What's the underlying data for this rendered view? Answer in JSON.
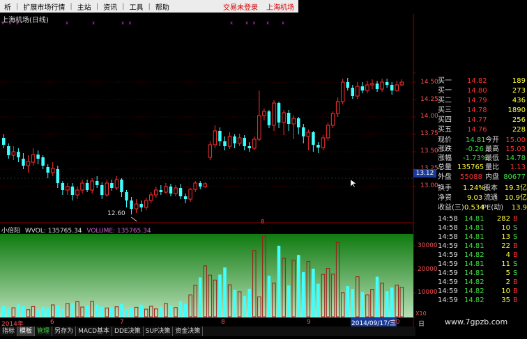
{
  "menu": {
    "items": [
      "析",
      "扩展市场行情",
      "主站",
      "资讯",
      "工具",
      "帮助"
    ],
    "status_right": [
      "交易未登录",
      "上海机场"
    ]
  },
  "stock": {
    "name_line": "上海机场(日线)"
  },
  "price_axis": {
    "labels": [
      "14.50",
      "14.25",
      "14.00",
      "13.75",
      "13.50",
      "13.25",
      "13.00"
    ],
    "cursor_value": "13.12"
  },
  "volume_axis": {
    "labels": [
      "30000",
      "20000",
      "10000"
    ],
    "unit_label": "X10"
  },
  "volume_header": {
    "indicator": "小倍阳",
    "wvol": "WVOL: 135765.34",
    "volume": "VOLUME: 135765.34"
  },
  "low_marker": "12.60",
  "date_axis": {
    "labels": [
      "2014年",
      "6",
      "7",
      "8",
      "9",
      "10"
    ],
    "cursor_date": "2014/09/17/三",
    "right_label": "日"
  },
  "order_book": [
    {
      "label": "买一",
      "price": "14.82",
      "vol": "189"
    },
    {
      "label": "买一",
      "price": "14.80",
      "vol": "273"
    },
    {
      "label": "买二",
      "price": "14.79",
      "vol": "436"
    },
    {
      "label": "买三",
      "price": "14.78",
      "vol": "1890"
    },
    {
      "label": "买四",
      "price": "14.77",
      "vol": "256"
    },
    {
      "label": "买五",
      "price": "14.76",
      "vol": "228"
    }
  ],
  "quote": [
    {
      "l1": "现价",
      "v1": "14.81",
      "l2": "今开",
      "v2": "15.00"
    },
    {
      "l1": "涨跌",
      "v1": "-0.26",
      "l2": "最高",
      "v2": "15.03"
    },
    {
      "l1": "涨幅",
      "v1": "-1.73%",
      "l2": "最低",
      "v2": "14.78"
    },
    {
      "l1": "总量",
      "v1": "135765",
      "l2": "量比",
      "v2": "1.13"
    },
    {
      "l1": "外盘",
      "v1": "55088",
      "l2": "内盘",
      "v2": "80677"
    }
  ],
  "stats": [
    {
      "l1": "换手",
      "v1": "1.24%",
      "l2": "股本",
      "v2": "19.3亿"
    },
    {
      "l1": "净资",
      "v1": "9.03",
      "l2": "流通",
      "v2": "10.9亿"
    },
    {
      "l1": "收益(三)",
      "v1": "0.534",
      "l2": "PE(动)",
      "v2": "13.9"
    }
  ],
  "ticks": [
    {
      "time": "14:58",
      "price": "14.81",
      "vol": "282",
      "side": "B"
    },
    {
      "time": "14:58",
      "price": "14.81",
      "vol": "10",
      "side": "S"
    },
    {
      "time": "14:58",
      "price": "14.81",
      "vol": "13",
      "side": "S"
    },
    {
      "time": "14:59",
      "price": "14.81",
      "vol": "22",
      "side": "B"
    },
    {
      "time": "14:59",
      "price": "14.82",
      "vol": "4",
      "side": "B"
    },
    {
      "time": "14:59",
      "price": "14.81",
      "vol": "11",
      "side": "S"
    },
    {
      "time": "14:59",
      "price": "14.81",
      "vol": "5",
      "side": "S"
    },
    {
      "time": "14:59",
      "price": "14.82",
      "vol": "2",
      "side": "B"
    },
    {
      "time": "14:59",
      "price": "14.82",
      "vol": "10",
      "side": "B"
    },
    {
      "time": "14:59",
      "price": "14.82",
      "vol": "35",
      "side": "B"
    }
  ],
  "tabs": [
    "指标",
    "模板",
    "管理",
    "另存为",
    "MACD基本",
    "DDE决策",
    "SUP决策",
    "资金决策"
  ],
  "watermark": "www.7gpzb.com",
  "colors": {
    "up": "#ff3030",
    "down": "#40ffff",
    "grid": "#8b0000",
    "menubar": "#ececec",
    "vol_fill_top": "#0f7a0f",
    "vol_fill_bottom": "#b8e0b8",
    "buy": "#ff3030",
    "sell": "#40e040"
  },
  "chart_data": {
    "type": "candlestick",
    "candles": [
      {
        "o": 13.7,
        "c": 13.6,
        "h": 13.75,
        "l": 13.55
      },
      {
        "o": 13.58,
        "c": 13.45,
        "h": 13.62,
        "l": 13.4
      },
      {
        "o": 13.45,
        "c": 13.5,
        "h": 13.58,
        "l": 13.38
      },
      {
        "o": 13.5,
        "c": 13.42,
        "h": 13.55,
        "l": 13.35
      },
      {
        "o": 13.4,
        "c": 13.3,
        "h": 13.48,
        "l": 13.25
      },
      {
        "o": 13.3,
        "c": 13.36,
        "h": 13.45,
        "l": 13.2
      },
      {
        "o": 13.35,
        "c": 13.46,
        "h": 13.55,
        "l": 13.3
      },
      {
        "o": 13.46,
        "c": 13.4,
        "h": 13.52,
        "l": 13.32
      },
      {
        "o": 13.42,
        "c": 13.3,
        "h": 13.45,
        "l": 13.25
      },
      {
        "o": 13.28,
        "c": 13.2,
        "h": 13.32,
        "l": 13.12
      },
      {
        "o": 13.2,
        "c": 13.26,
        "h": 13.35,
        "l": 13.15
      },
      {
        "o": 13.25,
        "c": 13.05,
        "h": 13.3,
        "l": 12.98
      },
      {
        "o": 13.05,
        "c": 12.95,
        "h": 13.08,
        "l": 12.88
      },
      {
        "o": 12.95,
        "c": 13.0,
        "h": 13.05,
        "l": 12.88
      },
      {
        "o": 13.0,
        "c": 12.88,
        "h": 13.05,
        "l": 12.8
      },
      {
        "o": 12.88,
        "c": 12.95,
        "h": 13.0,
        "l": 12.82
      },
      {
        "o": 12.95,
        "c": 13.05,
        "h": 13.1,
        "l": 12.9
      },
      {
        "o": 13.05,
        "c": 12.95,
        "h": 13.1,
        "l": 12.92
      },
      {
        "o": 12.95,
        "c": 13.08,
        "h": 13.12,
        "l": 12.9
      },
      {
        "o": 13.08,
        "c": 13.02,
        "h": 13.15,
        "l": 12.98
      },
      {
        "o": 13.02,
        "c": 12.88,
        "h": 13.06,
        "l": 12.82
      },
      {
        "o": 12.88,
        "c": 13.05,
        "h": 13.1,
        "l": 12.85
      },
      {
        "o": 13.05,
        "c": 12.98,
        "h": 13.1,
        "l": 12.94
      },
      {
        "o": 12.98,
        "c": 13.1,
        "h": 13.15,
        "l": 12.95
      },
      {
        "o": 13.1,
        "c": 12.92,
        "h": 13.12,
        "l": 12.85
      },
      {
        "o": 12.92,
        "c": 12.8,
        "h": 12.95,
        "l": 12.7
      },
      {
        "o": 12.8,
        "c": 12.68,
        "h": 12.85,
        "l": 12.6
      },
      {
        "o": 12.68,
        "c": 12.75,
        "h": 12.82,
        "l": 12.62
      },
      {
        "o": 12.75,
        "c": 12.7,
        "h": 12.8,
        "l": 12.64
      },
      {
        "o": 12.7,
        "c": 12.8,
        "h": 12.84,
        "l": 12.66
      },
      {
        "o": 12.8,
        "c": 12.88,
        "h": 12.92,
        "l": 12.76
      },
      {
        "o": 12.88,
        "c": 12.95,
        "h": 13.0,
        "l": 12.84
      },
      {
        "o": 12.95,
        "c": 12.92,
        "h": 13.02,
        "l": 12.88
      },
      {
        "o": 12.92,
        "c": 13.0,
        "h": 13.05,
        "l": 12.9
      },
      {
        "o": 13.0,
        "c": 12.9,
        "h": 13.04,
        "l": 12.86
      },
      {
        "o": 12.9,
        "c": 12.98,
        "h": 13.02,
        "l": 12.86
      },
      {
        "o": 12.98,
        "c": 12.86,
        "h": 13.04,
        "l": 12.82
      },
      {
        "o": 12.86,
        "c": 12.82,
        "h": 12.9,
        "l": 12.76
      },
      {
        "o": 12.82,
        "c": 12.96,
        "h": 12.98,
        "l": 12.78
      },
      {
        "o": 12.96,
        "c": 13.05,
        "h": 13.08,
        "l": 12.92
      },
      {
        "o": 13.05,
        "c": 13.0,
        "h": 13.08,
        "l": 12.96
      },
      {
        "o": 13.0,
        "c": 13.04,
        "h": 13.06,
        "l": 12.98
      },
      {
        "o": 13.42,
        "c": 13.6,
        "h": 13.65,
        "l": 13.38
      },
      {
        "o": 13.6,
        "c": 13.8,
        "h": 13.88,
        "l": 13.55
      },
      {
        "o": 13.8,
        "c": 13.65,
        "h": 13.85,
        "l": 13.58
      },
      {
        "o": 13.65,
        "c": 13.58,
        "h": 13.72,
        "l": 13.52
      },
      {
        "o": 13.58,
        "c": 13.72,
        "h": 13.78,
        "l": 13.54
      },
      {
        "o": 13.72,
        "c": 13.62,
        "h": 13.75,
        "l": 13.55
      },
      {
        "o": 13.62,
        "c": 13.7,
        "h": 13.76,
        "l": 13.58
      },
      {
        "o": 13.7,
        "c": 13.58,
        "h": 13.74,
        "l": 13.52
      },
      {
        "o": 13.58,
        "c": 13.55,
        "h": 13.64,
        "l": 13.5
      },
      {
        "o": 13.55,
        "c": 13.68,
        "h": 13.72,
        "l": 13.52
      },
      {
        "o": 13.68,
        "c": 14.02,
        "h": 14.38,
        "l": 13.65
      },
      {
        "o": 14.02,
        "c": 14.08,
        "h": 14.12,
        "l": 13.95
      },
      {
        "o": 14.08,
        "c": 13.88,
        "h": 14.1,
        "l": 13.84
      },
      {
        "o": 13.88,
        "c": 14.2,
        "h": 14.24,
        "l": 13.8
      },
      {
        "o": 14.2,
        "c": 13.92,
        "h": 14.22,
        "l": 13.84
      },
      {
        "o": 13.92,
        "c": 14.06,
        "h": 14.1,
        "l": 13.74
      },
      {
        "o": 14.06,
        "c": 13.9,
        "h": 14.1,
        "l": 13.8
      },
      {
        "o": 13.9,
        "c": 13.98,
        "h": 14.02,
        "l": 13.68
      },
      {
        "o": 13.98,
        "c": 13.85,
        "h": 14.0,
        "l": 13.75
      },
      {
        "o": 13.85,
        "c": 13.72,
        "h": 13.9,
        "l": 13.62
      },
      {
        "o": 13.72,
        "c": 13.78,
        "h": 13.82,
        "l": 13.52
      },
      {
        "o": 13.78,
        "c": 13.6,
        "h": 13.8,
        "l": 13.5
      },
      {
        "o": 13.6,
        "c": 13.56,
        "h": 13.64,
        "l": 13.48
      },
      {
        "o": 13.56,
        "c": 13.7,
        "h": 13.74,
        "l": 13.52
      },
      {
        "o": 13.7,
        "c": 13.88,
        "h": 13.92,
        "l": 13.66
      },
      {
        "o": 13.88,
        "c": 14.05,
        "h": 14.08,
        "l": 13.84
      },
      {
        "o": 14.05,
        "c": 14.22,
        "h": 14.28,
        "l": 14.0
      },
      {
        "o": 14.22,
        "c": 14.5,
        "h": 14.55,
        "l": 14.18
      },
      {
        "o": 14.5,
        "c": 14.42,
        "h": 14.56,
        "l": 14.38
      },
      {
        "o": 14.42,
        "c": 14.3,
        "h": 14.46,
        "l": 14.26
      },
      {
        "o": 14.3,
        "c": 14.44,
        "h": 14.5,
        "l": 14.26
      },
      {
        "o": 14.44,
        "c": 14.38,
        "h": 14.5,
        "l": 14.34
      },
      {
        "o": 14.38,
        "c": 14.46,
        "h": 14.52,
        "l": 14.34
      },
      {
        "o": 14.46,
        "c": 14.48,
        "h": 14.54,
        "l": 14.4
      },
      {
        "o": 14.48,
        "c": 14.4,
        "h": 14.52,
        "l": 14.36
      },
      {
        "o": 14.4,
        "c": 14.5,
        "h": 14.55,
        "l": 14.36
      },
      {
        "o": 14.5,
        "c": 14.46,
        "h": 14.55,
        "l": 14.42
      },
      {
        "o": 14.46,
        "c": 14.38,
        "h": 14.5,
        "l": 14.32
      },
      {
        "o": 14.38,
        "c": 14.46,
        "h": 14.52,
        "l": 14.36
      },
      {
        "o": 14.46,
        "c": 14.5,
        "h": 14.54,
        "l": 14.44
      }
    ],
    "volumes": [
      4500,
      3500,
      3800,
      5200,
      4600,
      3000,
      4300,
      2800,
      4200,
      3600,
      5000,
      4700,
      3400,
      5600,
      5800,
      6400,
      4100,
      4800,
      6500,
      5100,
      4300,
      3700,
      3900,
      4200,
      5300,
      3200,
      3900,
      4000,
      5100,
      3200,
      4400,
      3300,
      4100,
      5600,
      4800,
      3900,
      6600,
      5400,
      9200,
      13300,
      16600,
      21500,
      17600,
      15500,
      17800,
      20800,
      13500,
      11300,
      10600,
      8800,
      11800,
      28000,
      8400,
      34000,
      17300,
      14200,
      30000,
      24700,
      13200,
      23900,
      26100,
      18800,
      23400,
      20300,
      13900,
      17900,
      20400,
      18000,
      31400,
      10100,
      12900,
      11700,
      16900,
      10400,
      9200,
      11600,
      16900,
      14200,
      10800,
      12300,
      13400,
      12500
    ]
  }
}
